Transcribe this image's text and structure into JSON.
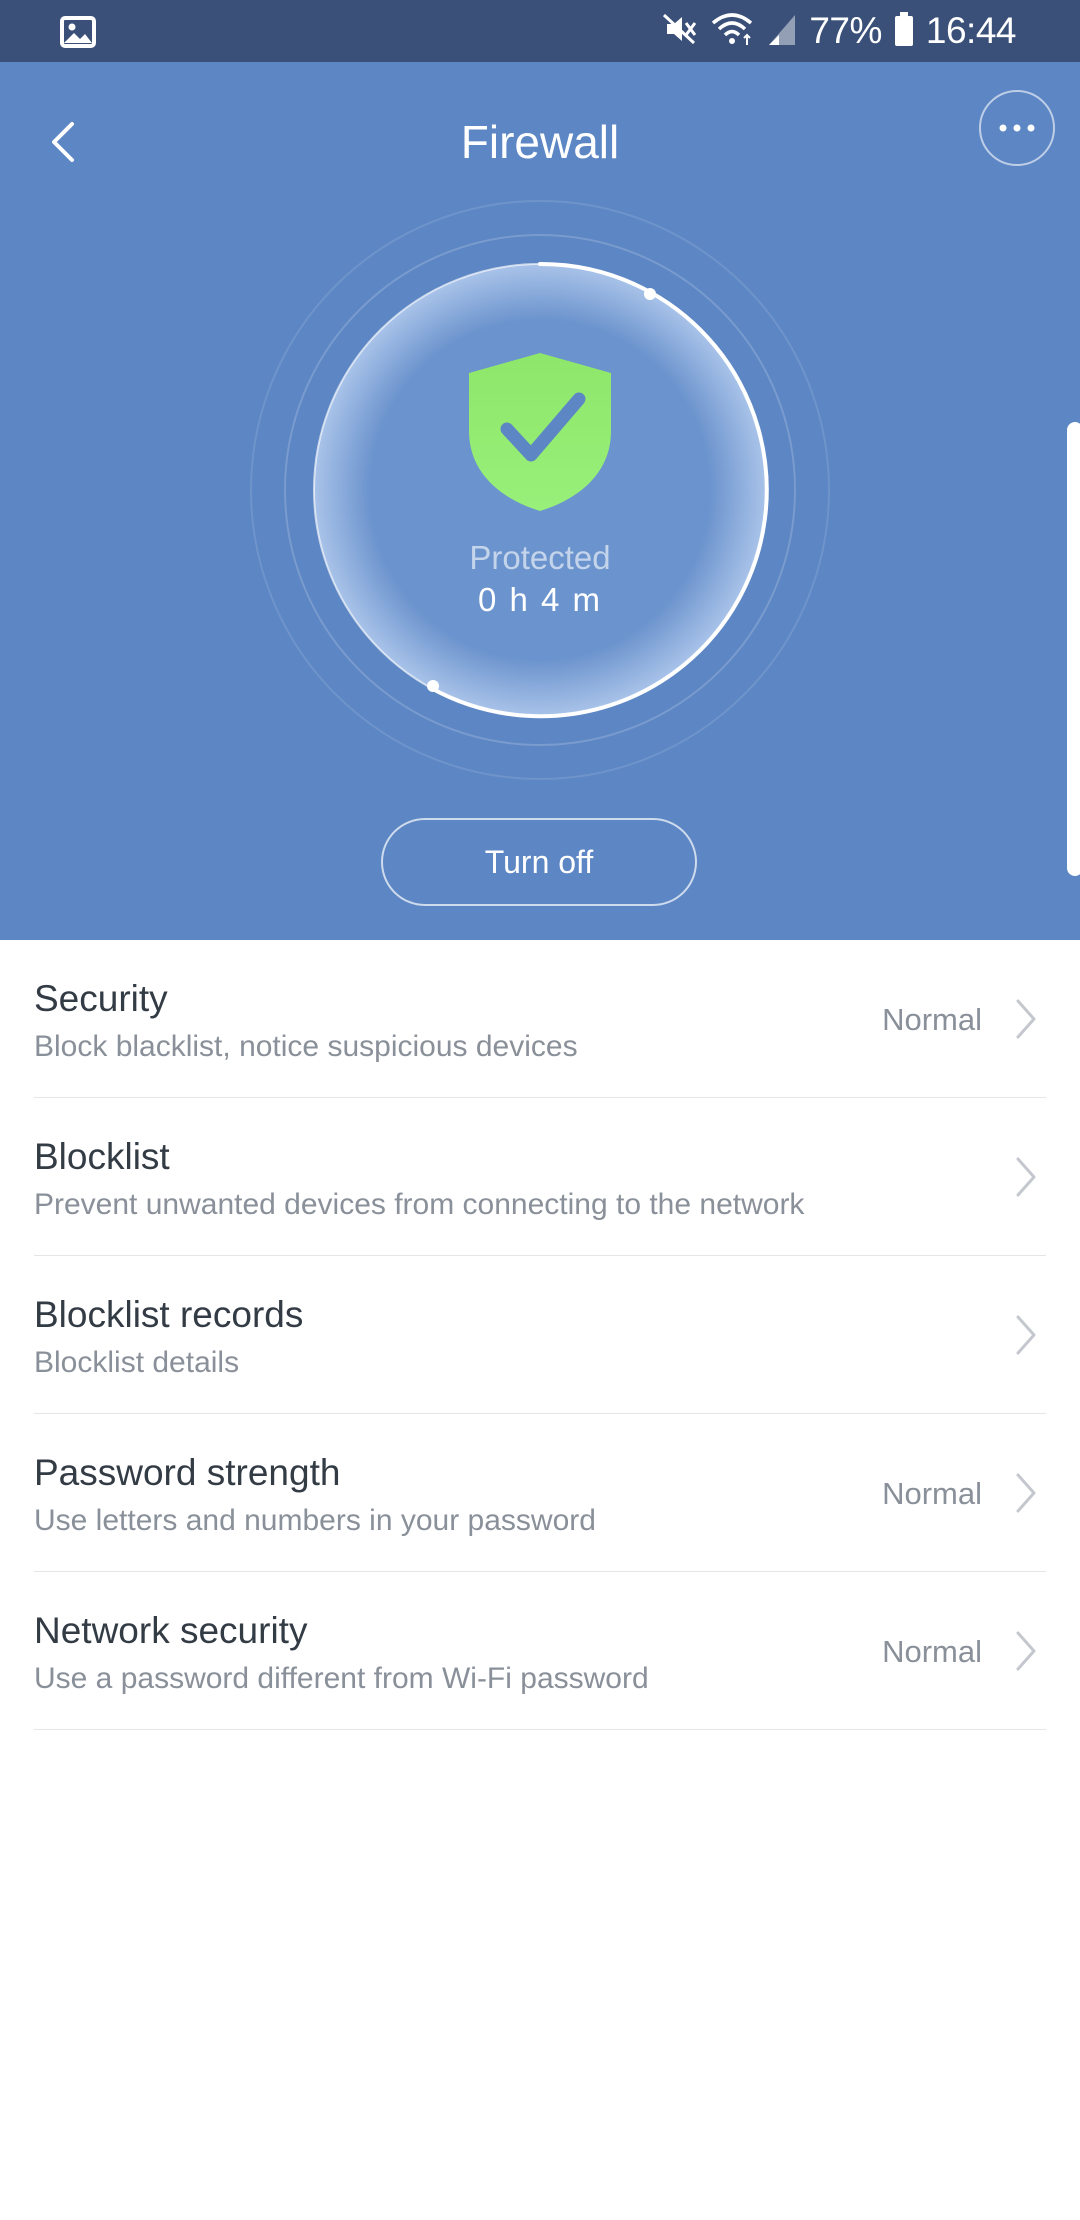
{
  "status_bar": {
    "battery_percent": "77%",
    "time": "16:44",
    "icons": [
      "gallery-icon",
      "mute-icon",
      "wifi-icon",
      "signal-icon",
      "battery-icon"
    ]
  },
  "header": {
    "title": "Firewall",
    "back_icon": "chevron-left-icon",
    "more_icon": "more-dots-icon",
    "status_label": "Protected",
    "protected_time": "0 h 4 m",
    "shield_icon": "shield-check-icon",
    "turn_off_label": "Turn off"
  },
  "colors": {
    "status_bar": "#3a5078",
    "header_bg": "#5c86c4",
    "shield_green": "#8ee66a",
    "text_primary": "#333b45",
    "text_secondary": "#8a9099"
  },
  "settings": [
    {
      "title": "Security",
      "subtitle": "Block blacklist, notice suspicious devices",
      "value": "Normal"
    },
    {
      "title": "Blocklist",
      "subtitle": "Prevent unwanted devices from connecting to the network",
      "value": ""
    },
    {
      "title": "Blocklist records",
      "subtitle": "Blocklist details",
      "value": ""
    },
    {
      "title": "Password strength",
      "subtitle": "Use letters and numbers in your password",
      "value": "Normal"
    },
    {
      "title": "Network security",
      "subtitle": "Use a password different from Wi-Fi password",
      "value": "Normal"
    }
  ]
}
